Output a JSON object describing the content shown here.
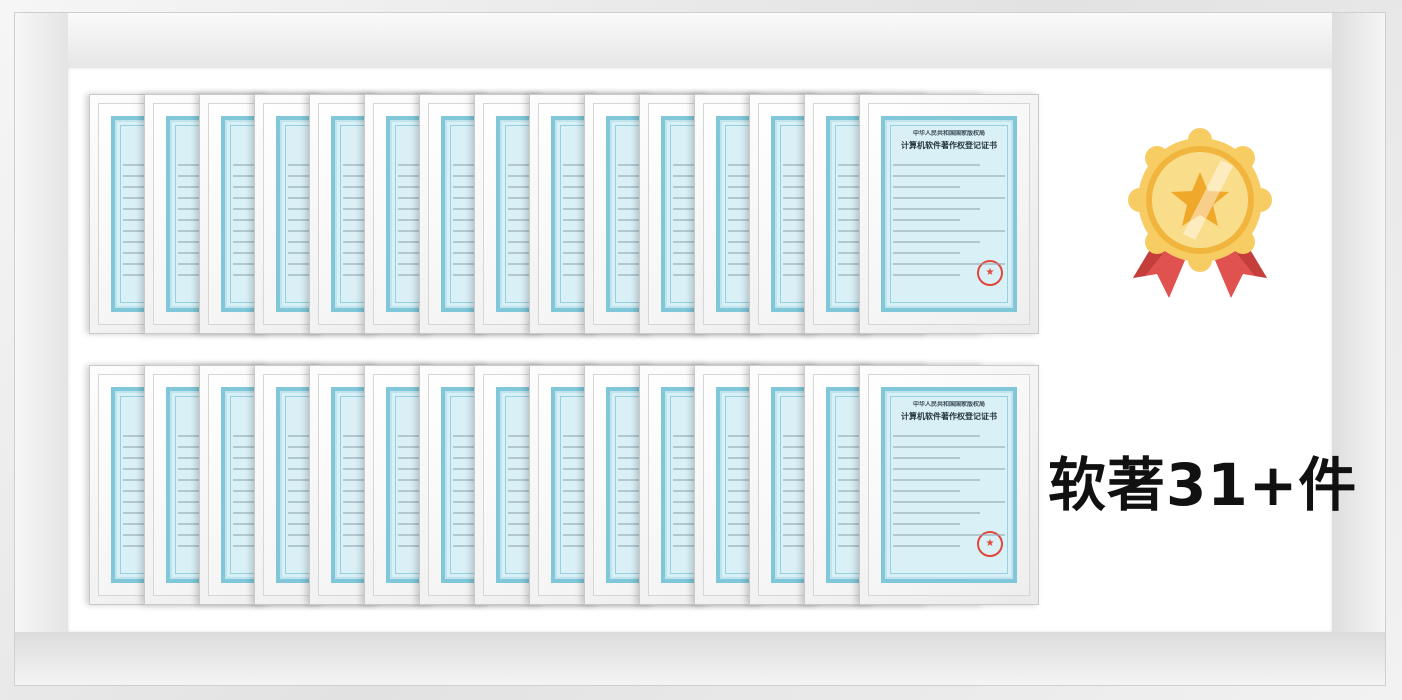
{
  "certificate": {
    "header": "中华人民共和国国家版权局",
    "title": "计算机软件著作权登记证书",
    "seal_icon": "star-seal-icon",
    "paper_color": "#d9f0f6",
    "border_color": "#7fc7d9",
    "seal_color": "#e0473a"
  },
  "rows": [
    {
      "count": 15
    },
    {
      "count": 15
    }
  ],
  "badge": {
    "icon": "award-medal-icon",
    "medal_color": "#f4c65a",
    "star_color": "#f0a82a",
    "ribbon_color": "#e0524f"
  },
  "summary": {
    "text": "软著31+件"
  }
}
